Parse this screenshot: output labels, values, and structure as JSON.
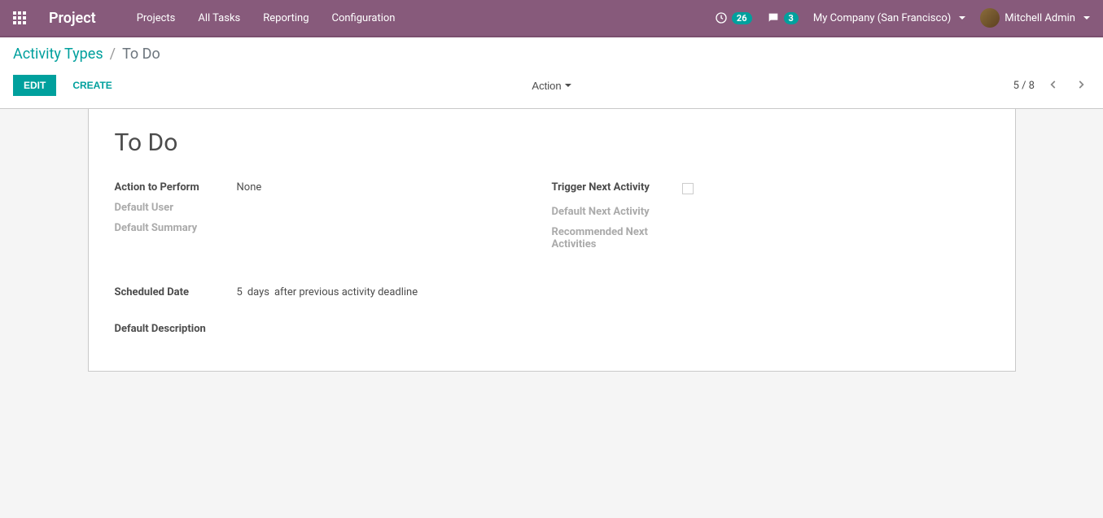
{
  "navbar": {
    "brand": "Project",
    "menu": [
      {
        "label": "Projects"
      },
      {
        "label": "All Tasks"
      },
      {
        "label": "Reporting"
      },
      {
        "label": "Configuration"
      }
    ],
    "activities_count": "26",
    "messages_count": "3",
    "company": "My Company (San Francisco)",
    "user": "Mitchell Admin"
  },
  "breadcrumb": {
    "parent": "Activity Types",
    "current": "To Do"
  },
  "buttons": {
    "edit": "Edit",
    "create": "Create",
    "action": "Action"
  },
  "pager": {
    "text": "5 / 8"
  },
  "form": {
    "title": "To Do",
    "fields": {
      "action_to_perform_label": "Action to Perform",
      "action_to_perform_value": "None",
      "default_user_label": "Default User",
      "default_summary_label": "Default Summary",
      "trigger_next_activity_label": "Trigger Next Activity",
      "default_next_activity_label": "Default Next Activity",
      "recommended_next_activities_label": "Recommended Next Activities",
      "scheduled_date_label": "Scheduled Date",
      "scheduled_days": "5",
      "scheduled_unit": "days",
      "scheduled_after": "after previous activity deadline",
      "default_description_label": "Default Description"
    }
  }
}
